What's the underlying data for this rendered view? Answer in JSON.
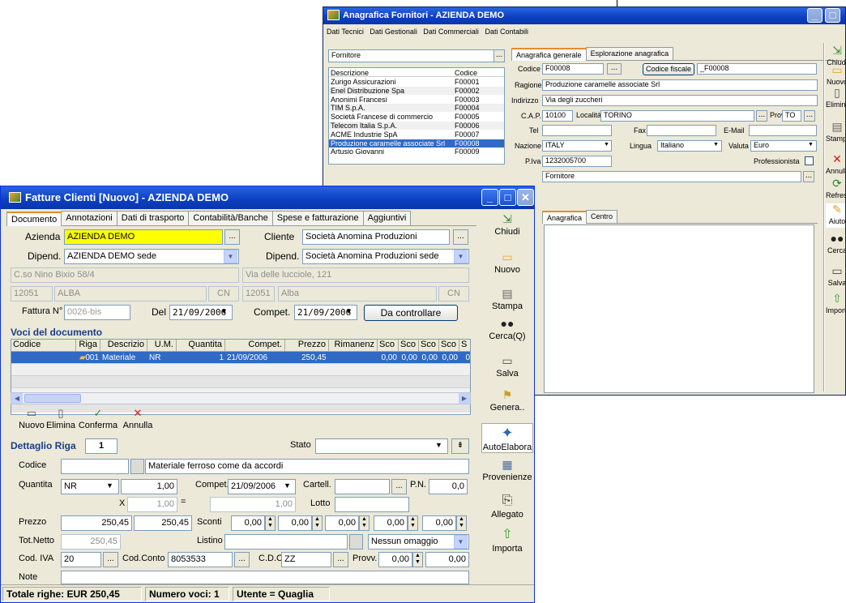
{
  "supplier_window": {
    "title": "Anagrafica Fornitori - AZIENDA DEMO",
    "menu": [
      "Dati Tecnici",
      "Dati Gestionali",
      "Dati Commerciali",
      "Dati Contabili"
    ],
    "filter_value": "Fornitore",
    "list_headers": {
      "description": "Descrizione",
      "code": "Codice"
    },
    "suppliers": [
      {
        "name": "Zurigo Assicurazioni",
        "code": "F00001"
      },
      {
        "name": "Enel Distribuzione Spa",
        "code": "F00002"
      },
      {
        "name": "Anonimi Francesi",
        "code": "F00003"
      },
      {
        "name": "TIM S.p.A.",
        "code": "F00004"
      },
      {
        "name": "Società Francese di commercio",
        "code": "F00005"
      },
      {
        "name": "Telecom Italia S.p.A.",
        "code": "F00006"
      },
      {
        "name": "ACME Industrie SpA",
        "code": "F00007"
      },
      {
        "name": "Produzione caramelle associate Srl",
        "code": "F00008"
      },
      {
        "name": "Artusio Giovanni",
        "code": "F00009"
      }
    ],
    "tabs": [
      "Anagrafica generale",
      "Esplorazione anagrafica"
    ],
    "form": {
      "codice_label": "Codice",
      "codice_value": "F00008",
      "codice_fiscale_button": "Codice fiscale",
      "codice_fiscale_value": "_F00008",
      "ragione_label": "Ragione",
      "ragione_value": "Produzione caramelle associate Srl",
      "indirizzo_label": "Indirizzo",
      "indirizzo_value": "Via degli zuccheri",
      "cap_label": "C.A.P.",
      "cap_value": "10100",
      "localita_label": "Località",
      "localita_value": "TORINO",
      "prov_label": "Prov.",
      "prov_value": "TO",
      "tel_label": "Tel",
      "fax_label": "Fax",
      "email_label": "E-Mail",
      "nazione_label": "Nazione",
      "nazione_value": "ITALY",
      "lingua_label": "Lingua",
      "lingua_value": "Italiano",
      "valuta_label": "Valuta",
      "valuta_value": "Euro",
      "piva_label": "P.Iva",
      "piva_value": "1232005700",
      "professionista_label": "Professionista",
      "tipo_value": "Fornitore"
    },
    "sub_tabs": [
      "Anagrafica",
      "Centro"
    ],
    "toolbar": [
      "Chiudi",
      "Nuovo",
      "Elimina",
      "Stampa",
      "Annulla",
      "Refresh",
      "Aiuto",
      "Cerca",
      "Salva",
      "Importa"
    ]
  },
  "invoice_window": {
    "title": "Fatture Clienti [Nuovo] - AZIENDA DEMO",
    "tabs": [
      "Documento",
      "Annotazioni",
      "Dati di trasporto",
      "Contabilità/Banche",
      "Spese e fatturazione",
      "Aggiuntivi"
    ],
    "header": {
      "azienda_label": "Azienda",
      "azienda_value": "AZIENDA DEMO",
      "cliente_label": "Cliente",
      "cliente_value": "Società Anomina Produzioni",
      "dipend_label": "Dipend.",
      "dipend_azienda_value": "AZIENDA DEMO sede",
      "dipend_cliente_value": "Società Anomina Produzioni sede",
      "indirizzo_azienda": "C.so Nino Bixio 58/4",
      "indirizzo_cliente": "Via delle lucciole, 121",
      "cap_azienda": "12051",
      "citta_azienda": "ALBA",
      "prov_azienda": "CN",
      "cap_cliente": "12051",
      "citta_cliente": "Alba",
      "prov_cliente": "CN",
      "fattura_label": "Fattura N°",
      "fattura_value": "0026-bis",
      "del_label": "Del",
      "del_value": "21/09/2006",
      "compet_label": "Compet.",
      "compet_value": "21/09/2006",
      "da_controllare_button": "Da controllare"
    },
    "voci_section": "Voci del documento",
    "grid_columns": [
      "Codice",
      "Riga",
      "Descrizio",
      "U.M.",
      "Quantita",
      "Compet.",
      "Prezzo",
      "Rimanenz",
      "Sco",
      "Sco",
      "Sco",
      "Sco",
      "S"
    ],
    "grid_row": {
      "riga": "001",
      "descrizione": "Materiale",
      "um": "NR",
      "quantita": "1",
      "compet": "21/09/2006",
      "prezzo": "250,45",
      "sconti": [
        "0,00",
        "0,00",
        "0,00",
        "0,00",
        "0"
      ]
    },
    "row_actions": {
      "nuovo": "Nuovo",
      "elimina": "Elimina",
      "conferma": "Conferma",
      "annulla": "Annulla"
    },
    "dettaglio": {
      "title": "Dettaglio Riga",
      "riga_value": "1",
      "stato_label": "Stato",
      "codice_label": "Codice",
      "descrizione_value": "Materiale ferroso come da accordi",
      "quantita_label": "Quantita",
      "um_value": "NR",
      "quantita_value": "1,00",
      "compet_label": "Compet.",
      "compet_value": "21/09/2006",
      "cartell_label": "Cartell.",
      "pn_label": "P.N.",
      "pn_value": "0,0",
      "x_label": "X",
      "x_value": "1,00",
      "eq_label": "=",
      "eq_value": "1,00",
      "lotto_label": "Lotto",
      "prezzo_label": "Prezzo",
      "prezzo_value": "250,45",
      "prezzo2_value": "250,45",
      "sconti_label": "Sconti",
      "sconti_values": [
        "0,00",
        "0,00",
        "0,00",
        "0,00",
        "0,00"
      ],
      "totnetto_label": "Tot.Netto",
      "totnetto_value": "250,45",
      "listino_label": "Listino",
      "omaggio_value": "Nessun omaggio",
      "codiva_label": "Cod. IVA",
      "codiva_value": "20",
      "codconto_label": "Cod.Conto",
      "codconto_value": "8053533",
      "cdc_label": "C.D.C.",
      "cdc_value": "ZZ",
      "provv_label": "Provv.",
      "provv_value": "0,00",
      "provv2_value": "0,00",
      "note_label": "Note"
    },
    "side_toolbar": [
      "Chiudi",
      "Nuovo",
      "Stampa",
      "Cerca(Q)",
      "Salva",
      "Genera..",
      "AutoElabora",
      "Provenienze",
      "Allegato",
      "Importa"
    ],
    "status_bar": [
      "Totale righe: EUR 250,45",
      "Numero voci: 1",
      "Utente = Quaglia"
    ]
  }
}
